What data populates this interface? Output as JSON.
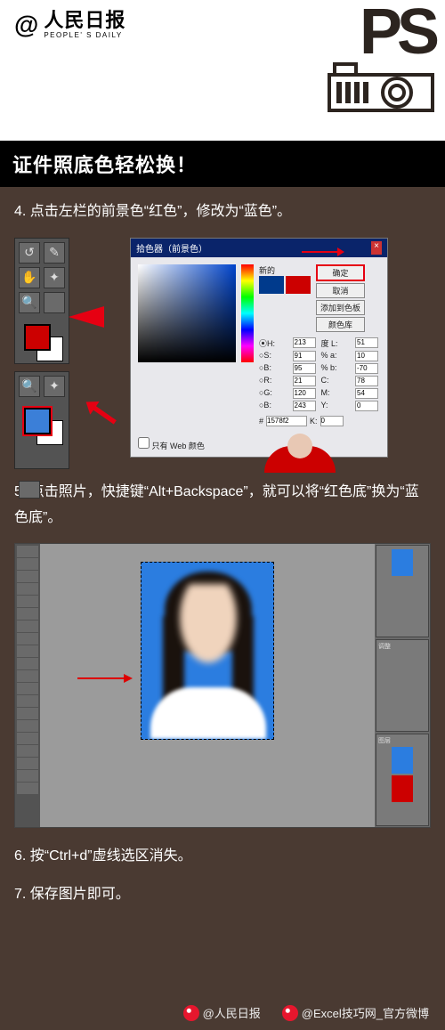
{
  "brand": {
    "at": "@",
    "cn": "人民日报",
    "en": "PEOPLE' S DAILY",
    "ps": "PS"
  },
  "title": "证件照底色轻松换！",
  "steps": {
    "s4": "4. 点击左栏的前景色“红色”，修改为“蓝色”。",
    "s5": "5. 点击照片，快捷键“Alt+Backspace”，就可以将“红色底”换为“蓝色底”。",
    "s6": "6. 按“Ctrl+d”虚线选区消失。",
    "s7": "7. 保存图片即可。"
  },
  "picker": {
    "title": "拾色器（前景色）",
    "new_label": "新的",
    "btn_ok": "确定",
    "btn_cancel": "取消",
    "btn_add": "添加到色板",
    "btn_lib": "颜色库",
    "web_only": "只有 Web 颜色",
    "vals": {
      "H": "213",
      "S": "91",
      "B": "95",
      "R": "21",
      "G": "120",
      "Bl": "243",
      "L": "51",
      "a": "10",
      "b2": "-70",
      "C": "78",
      "M": "54",
      "Y": "0",
      "K": "0"
    },
    "hex": "1578f2"
  },
  "footer": {
    "a": "@人民日报",
    "b": "@Excel技巧网_官方微博"
  }
}
